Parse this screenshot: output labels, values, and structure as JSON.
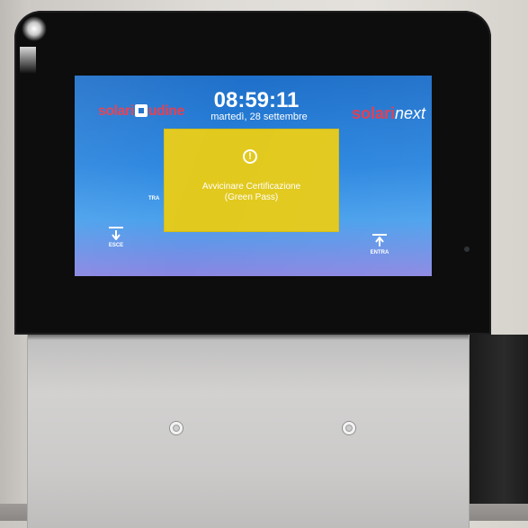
{
  "screen": {
    "logo_left": {
      "before_box": "solari",
      "after_box": "udine"
    },
    "logo_right": {
      "brand": "solari",
      "suffix": "next"
    },
    "time": "08:59:11",
    "date": "martedì, 28 settembre",
    "dialog": {
      "icon": "alert-circle-icon",
      "line1": "Avvicinare Certificazione",
      "line2": "(Green Pass)",
      "background_color": "#e2c91d"
    },
    "transit_label_partial": "TRA",
    "exit_button": {
      "label": "ESCE",
      "icon": "arrow-down-icon"
    },
    "enter_button": {
      "label": "ENTRA",
      "icon": "arrow-up-icon"
    }
  },
  "colors": {
    "screen_blue": "#2b86df",
    "logo_red": "#e13b50",
    "bezel": "#0d0d0e"
  }
}
